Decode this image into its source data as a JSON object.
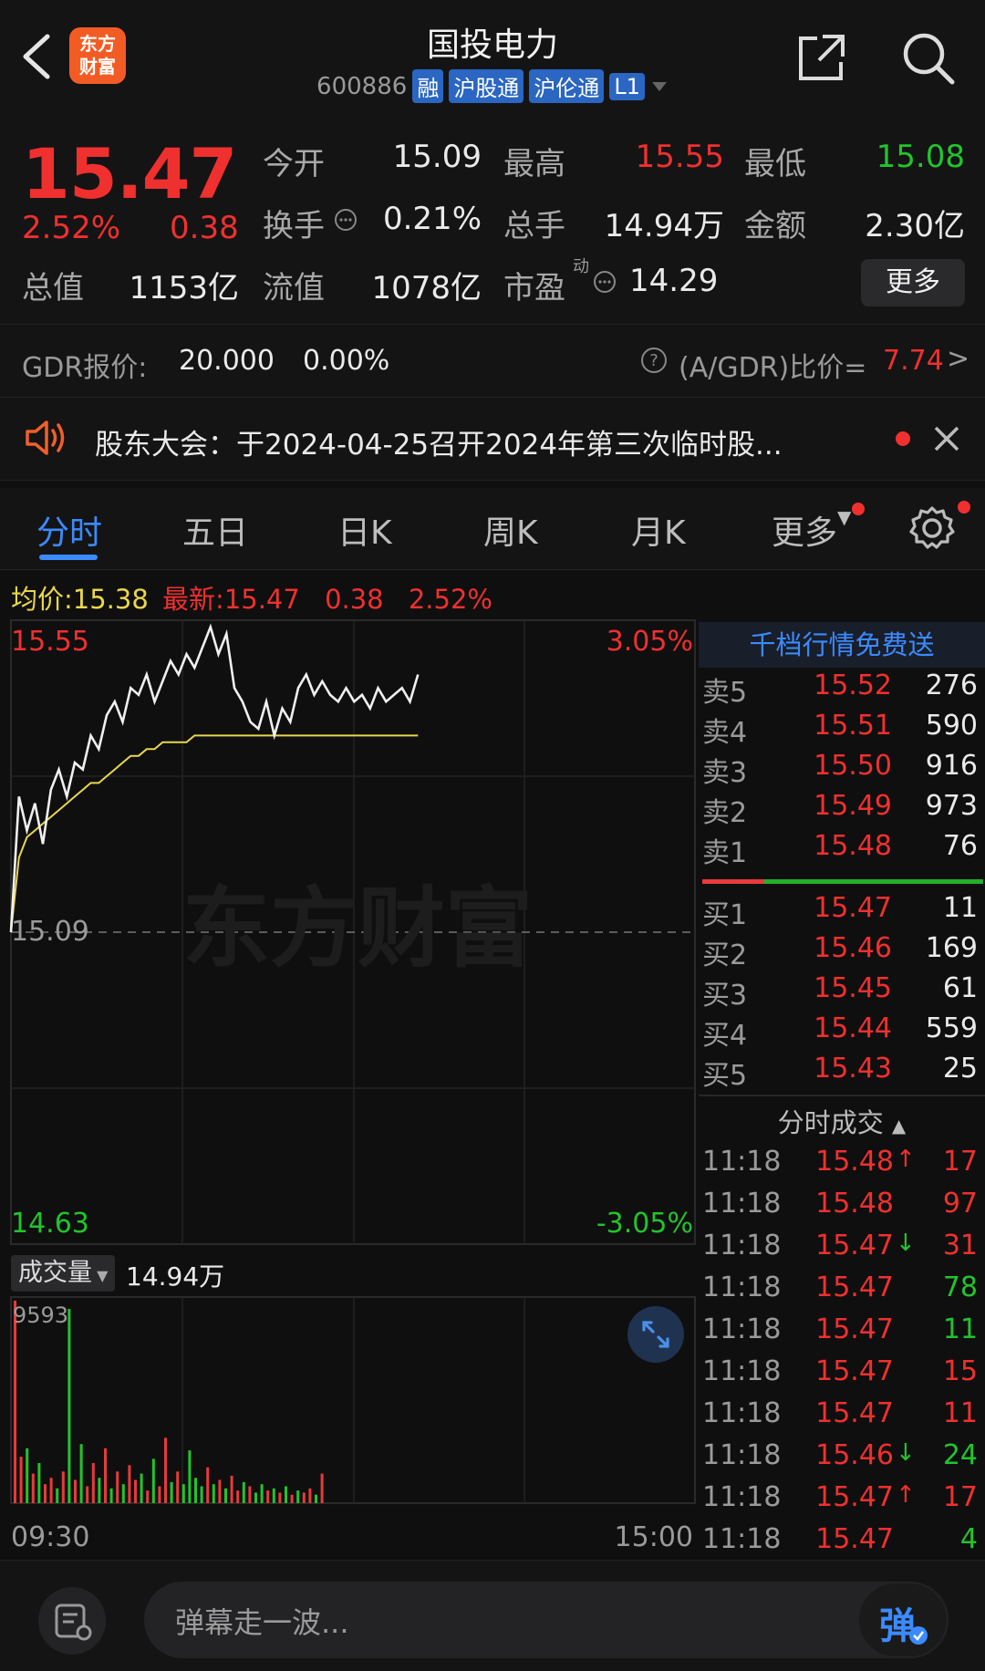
{
  "header": {
    "title": "国投电力",
    "code": "600886",
    "tags": [
      "融",
      "沪股通",
      "沪伦通",
      "L1"
    ],
    "logo_line1": "东方",
    "logo_line2": "财富"
  },
  "quote": {
    "price": "15.47",
    "change_pct": "2.52%",
    "change": "0.38",
    "open_label": "今开",
    "open": "15.09",
    "high_label": "最高",
    "high": "15.55",
    "low_label": "最低",
    "low": "15.08",
    "turnover_label": "换手",
    "turnover": "0.21%",
    "volume_label": "总手",
    "volume": "14.94万",
    "amount_label": "金额",
    "amount": "2.30亿",
    "mktcap_label": "总值",
    "mktcap": "1153亿",
    "float_label": "流值",
    "float": "1078亿",
    "pe_label": "市盈",
    "pe_sup": "动",
    "pe": "14.29",
    "more_button": "更多"
  },
  "gdr": {
    "label": "GDR报价:",
    "price": "20.000",
    "pct": "0.00%",
    "ratio_label": "(A/GDR)比价=",
    "ratio": "7.74",
    "arrow": ">"
  },
  "notice": {
    "text": "股东大会：于2024-04-25召开2024年第三次临时股..."
  },
  "tabs": [
    "分时",
    "五日",
    "日K",
    "周K",
    "月K",
    "更多"
  ],
  "info_line": {
    "avg_label": "均价:",
    "avg": "15.38",
    "latest_label": "最新:",
    "latest": "15.47",
    "chg": "0.38",
    "pct": "2.52%"
  },
  "chart": {
    "y_top": "15.55",
    "y_mid": "15.09",
    "y_bot": "14.63",
    "pct_top": "3.05%",
    "pct_bot": "-3.05%",
    "watermark": "东方财富",
    "volume_label": "成交量",
    "volume_value": "14.94万",
    "vol_max": "9593",
    "time_start": "09:30",
    "time_end": "15:00"
  },
  "chart_data": {
    "type": "line",
    "series": [],
    "ylim": [
      14.63,
      15.55
    ],
    "price": [
      15.09,
      15.29,
      15.24,
      15.28,
      15.22,
      15.3,
      15.33,
      15.29,
      15.34,
      15.33,
      15.38,
      15.36,
      15.41,
      15.43,
      15.4,
      15.45,
      15.44,
      15.47,
      15.43,
      15.46,
      15.49,
      15.47,
      15.5,
      15.48,
      15.51,
      15.54,
      15.5,
      15.53,
      15.45,
      15.43,
      15.4,
      15.39,
      15.43,
      15.38,
      15.42,
      15.4,
      15.45,
      15.47,
      15.44,
      15.46,
      15.44,
      15.43,
      15.45,
      15.43,
      15.44,
      15.42,
      15.45,
      15.43,
      15.44,
      15.45,
      15.43,
      15.47
    ],
    "avg": [
      15.09,
      15.2,
      15.23,
      15.24,
      15.25,
      15.26,
      15.27,
      15.28,
      15.29,
      15.3,
      15.31,
      15.31,
      15.32,
      15.33,
      15.34,
      15.35,
      15.35,
      15.36,
      15.36,
      15.37,
      15.37,
      15.37,
      15.37,
      15.38,
      15.38,
      15.38,
      15.38,
      15.38,
      15.38,
      15.38,
      15.38,
      15.38,
      15.38,
      15.38,
      15.38,
      15.38,
      15.38,
      15.38,
      15.38,
      15.38,
      15.38,
      15.38,
      15.38,
      15.38,
      15.38,
      15.38,
      15.38,
      15.38,
      15.38,
      15.38,
      15.38,
      15.38
    ],
    "volume_max": 9593
  },
  "order_book": {
    "header": "千档行情免费送",
    "asks": [
      {
        "label": "卖5",
        "price": "15.52",
        "vol": "276"
      },
      {
        "label": "卖4",
        "price": "15.51",
        "vol": "590"
      },
      {
        "label": "卖3",
        "price": "15.50",
        "vol": "916"
      },
      {
        "label": "卖2",
        "price": "15.49",
        "vol": "973"
      },
      {
        "label": "卖1",
        "price": "15.48",
        "vol": "76"
      }
    ],
    "bids": [
      {
        "label": "买1",
        "price": "15.47",
        "vol": "11"
      },
      {
        "label": "买2",
        "price": "15.46",
        "vol": "169"
      },
      {
        "label": "买3",
        "price": "15.45",
        "vol": "61"
      },
      {
        "label": "买4",
        "price": "15.44",
        "vol": "559"
      },
      {
        "label": "买5",
        "price": "15.43",
        "vol": "25"
      }
    ],
    "trades_header": "分时成交",
    "trades": [
      {
        "time": "11:18",
        "price": "15.48",
        "arrow": "↑",
        "vol": "17",
        "vol_color": "red"
      },
      {
        "time": "11:18",
        "price": "15.48",
        "arrow": "",
        "vol": "97",
        "vol_color": "red"
      },
      {
        "time": "11:18",
        "price": "15.47",
        "arrow": "↓",
        "vol": "31",
        "vol_color": "red"
      },
      {
        "time": "11:18",
        "price": "15.47",
        "arrow": "",
        "vol": "78",
        "vol_color": "green"
      },
      {
        "time": "11:18",
        "price": "15.47",
        "arrow": "",
        "vol": "11",
        "vol_color": "green"
      },
      {
        "time": "11:18",
        "price": "15.47",
        "arrow": "",
        "vol": "15",
        "vol_color": "red"
      },
      {
        "time": "11:18",
        "price": "15.47",
        "arrow": "",
        "vol": "11",
        "vol_color": "red"
      },
      {
        "time": "11:18",
        "price": "15.46",
        "arrow": "↓",
        "vol": "24",
        "vol_color": "green"
      },
      {
        "time": "11:18",
        "price": "15.47",
        "arrow": "↑",
        "vol": "17",
        "vol_color": "red"
      },
      {
        "time": "11:18",
        "price": "15.47",
        "arrow": "",
        "vol": "4",
        "vol_color": "green"
      }
    ]
  },
  "bottom": {
    "placeholder": "弹幕走一波...",
    "danmu_button": "弹"
  },
  "colors": {
    "up": "#f0302e",
    "down": "#22c42b",
    "accent": "#3b8bff",
    "avg_line": "#e8d74a"
  }
}
